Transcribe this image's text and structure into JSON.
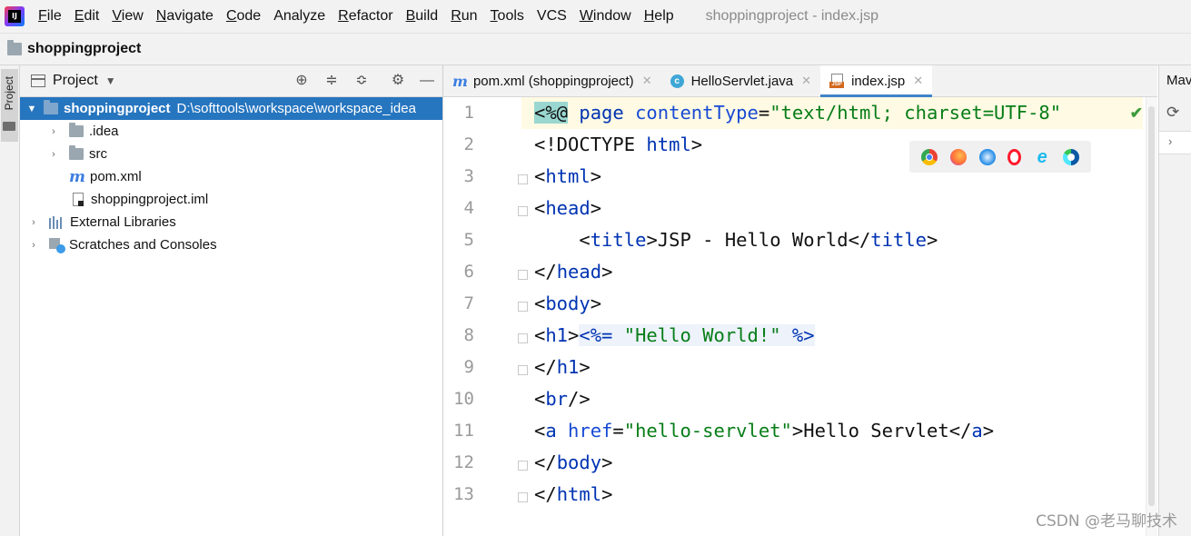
{
  "menu": {
    "items": [
      {
        "label": "File",
        "mnemonic": "F",
        "rest": "ile"
      },
      {
        "label": "Edit",
        "mnemonic": "E",
        "rest": "dit"
      },
      {
        "label": "View",
        "mnemonic": "V",
        "rest": "iew"
      },
      {
        "label": "Navigate",
        "mnemonic": "N",
        "rest": "avigate"
      },
      {
        "label": "Code",
        "mnemonic": "C",
        "rest": "ode"
      },
      {
        "label": "Analyze",
        "mnemonic": "",
        "rest": "Analyze"
      },
      {
        "label": "Refactor",
        "mnemonic": "R",
        "rest": "efactor"
      },
      {
        "label": "Build",
        "mnemonic": "B",
        "rest": "uild"
      },
      {
        "label": "Run",
        "mnemonic": "R",
        "rest": "un"
      },
      {
        "label": "Tools",
        "mnemonic": "T",
        "rest": "ools"
      },
      {
        "label": "VCS",
        "mnemonic": "",
        "rest": "VCS"
      },
      {
        "label": "Window",
        "mnemonic": "W",
        "rest": "indow"
      },
      {
        "label": "Help",
        "mnemonic": "H",
        "rest": "elp"
      }
    ],
    "window_title": "shoppingproject - index.jsp"
  },
  "navbar": {
    "project": "shoppingproject"
  },
  "left_strip": {
    "project_tab": "Project"
  },
  "project_panel": {
    "title": "Project",
    "root": {
      "name": "shoppingproject",
      "path": "D:\\softtools\\workspace\\workspace_idea"
    },
    "children": [
      {
        "name": ".idea",
        "type": "folder"
      },
      {
        "name": "src",
        "type": "folder"
      },
      {
        "name": "pom.xml",
        "type": "maven"
      },
      {
        "name": "shoppingproject.iml",
        "type": "iml"
      }
    ],
    "extra": [
      {
        "name": "External Libraries"
      },
      {
        "name": "Scratches and Consoles"
      }
    ]
  },
  "tabs": [
    {
      "label": "pom.xml (shoppingproject)",
      "icon": "maven-icon",
      "active": false
    },
    {
      "label": "HelloServlet.java",
      "icon": "class-icon",
      "active": false
    },
    {
      "label": "index.jsp",
      "icon": "jsp-icon",
      "active": true
    }
  ],
  "editor": {
    "line_numbers": [
      "1",
      "2",
      "3",
      "4",
      "5",
      "6",
      "7",
      "8",
      "9",
      "10",
      "11",
      "12",
      "13"
    ],
    "code": {
      "l1": {
        "open": "<%@",
        "kw1": "page",
        "attr": "contentType",
        "eq": "=",
        "val": "\"text/html; charset=UTF-8\""
      },
      "l2": {
        "a": "<!DOCTYPE ",
        "b": "html",
        "c": ">"
      },
      "l3": {
        "a": "<",
        "b": "html",
        "c": ">"
      },
      "l4": {
        "a": "<",
        "b": "head",
        "c": ">"
      },
      "l5": {
        "indent": "    ",
        "a": "<",
        "b": "title",
        "c": ">",
        "text": "JSP - Hello World",
        "d": "</",
        "e": "title",
        "f": ">"
      },
      "l6": {
        "a": "</",
        "b": "head",
        "c": ">"
      },
      "l7": {
        "a": "<",
        "b": "body",
        "c": ">"
      },
      "l8": {
        "a": "<",
        "b": "h1",
        "c": ">",
        "eo": "<%= ",
        "str": "\"Hello World!\"",
        "ec": " %>"
      },
      "l9": {
        "a": "</",
        "b": "h1",
        "c": ">"
      },
      "l10": {
        "a": "<",
        "b": "br",
        "c": "/>"
      },
      "l11": {
        "a": "<",
        "b": "a",
        "sp": " ",
        "attr": "href",
        "eq": "=",
        "val": "\"hello-servlet\"",
        "c": ">",
        "text": "Hello Servlet",
        "d": "</",
        "e": "a",
        "f": ">"
      },
      "l12": {
        "a": "</",
        "b": "body",
        "c": ">"
      },
      "l13": {
        "a": "</",
        "b": "html",
        "c": ">"
      }
    }
  },
  "browsers": [
    {
      "name": "chrome-icon",
      "color": "#4caf50"
    },
    {
      "name": "firefox-icon",
      "color": "#ff7139"
    },
    {
      "name": "safari-icon",
      "color": "#1e88e5"
    },
    {
      "name": "opera-icon",
      "color": "#ff1b2d"
    },
    {
      "name": "ie-icon",
      "color": "#1ebbee"
    },
    {
      "name": "edge-icon",
      "color": "#0c8ad6"
    }
  ],
  "right_panel": {
    "title": "Maven"
  },
  "watermark": "CSDN @老马聊技术"
}
